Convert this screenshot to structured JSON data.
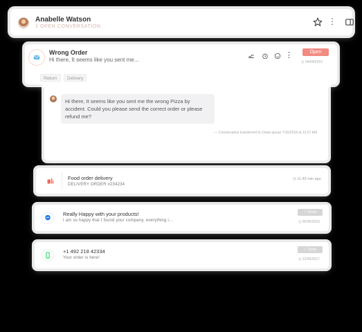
{
  "header": {
    "name": "Anabelle Watson",
    "status": "1 OPEN CONVERSATION"
  },
  "email": {
    "subject": "Wrong Order",
    "preview": "Hi there, It seems like you sent me...",
    "open_label": "Open",
    "date": "04/04/2019",
    "tags": [
      "Return",
      "Delivery"
    ]
  },
  "conversation": {
    "message": "Hi there, It seems like you sent me the wrong Pizza by accident. Could you please send the correct order or please refund me?",
    "meta": "— Conversation transferred to Chats queue 7/16/2018 at 12:07 AM"
  },
  "rows": {
    "food": {
      "title": "Food order delivery",
      "subtitle": "DELIVERY ORDER #234234",
      "time": "11:45 min ago"
    },
    "happy": {
      "title": "Really Happy with your products!",
      "preview": "I am so happy that I found your company, everything i...",
      "status": "Done",
      "date": "05/05/2018"
    },
    "phone": {
      "title": "+1 492 218 42334",
      "preview": "Your order is here!",
      "status": "Done",
      "date": "22/05/2017"
    }
  },
  "colors": {
    "accent": "#f28b82",
    "messenger": "#1877f2",
    "whatsapp": "#25d366",
    "food": "#ef6b5b"
  }
}
